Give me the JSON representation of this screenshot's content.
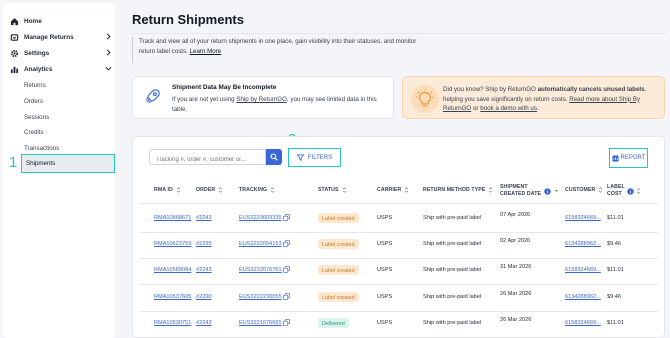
{
  "sidebar": {
    "home": "Home",
    "manage_returns": "Manage Returns",
    "settings": "Settings",
    "analytics": "Analytics",
    "analytics_items": [
      "Returns",
      "Orders",
      "Sessions",
      "Credits",
      "Transactions",
      "Shipments"
    ]
  },
  "annotations": [
    "1",
    "2",
    "3"
  ],
  "header": {
    "title": "Return Shipments",
    "intro": "Track and view all of your return shipments in one place, gain visibility into their statuses, and monitor return label costs.",
    "learn_more": "Learn More"
  },
  "notice": {
    "title": "Shipment Data May Be Incomplete",
    "text_before": "If you are not yet using",
    "link": "Ship by ReturnGO",
    "text_after": ", you may see limited data in this table."
  },
  "tip": {
    "text1": "Did you know? Ship by ReturnGO",
    "bold": "automatically cancels unused labels",
    "text2": ", helping you save significantly on return costs.",
    "link1": "Read more about Ship By ReturnGO",
    "text3": "or",
    "link2": "book a demo with us",
    "text4": "."
  },
  "toolbar": {
    "search_placeholder": "Tracking #, order #, customer or...",
    "filters_label": "FILTERS",
    "report_label": "REPORT"
  },
  "table": {
    "headers": {
      "rma": "RMA ID",
      "order": "ORDER",
      "tracking": "TRACKING",
      "status": "STATUS",
      "carrier": "CARRIER",
      "method": "RETURN METHOD TYPE",
      "created1": "SHIPMENT",
      "created2": "CREATED DATE",
      "customer": "CUSTOMER",
      "cost1": "LABEL",
      "cost2": "COST"
    },
    "rows": [
      {
        "rma": "RMA10868671",
        "order": "#2243",
        "tracking": "EUS3223603335",
        "status": "Label created",
        "carrier": "USPS",
        "method": "Ship with pre-paid label",
        "date": "07 Apr 2026",
        "customer": "6158324669...",
        "cost": "$11.01"
      },
      {
        "rma": "RMA10623759",
        "order": "#2295",
        "tracking": "EUS3222654153",
        "status": "Label created",
        "carrier": "USPS",
        "method": "Ship with pre-paid label",
        "date": "02 Apr 2026",
        "customer": "6134288962...",
        "cost": "$9.46"
      },
      {
        "rma": "RMA10589084",
        "order": "#2243",
        "tracking": "EUS3222076761",
        "status": "Label created",
        "carrier": "USPS",
        "method": "Ship with pre-paid label",
        "date": "31 Mar 2026",
        "customer": "6158324669...",
        "cost": "$11.01"
      },
      {
        "rma": "RMA10537605",
        "order": "#2290",
        "tracking": "EUS3222230055",
        "status": "Label created",
        "carrier": "USPS",
        "method": "Ship with pre-paid label",
        "date": "26 Mar 2026",
        "customer": "6134288962...",
        "cost": "$9.46"
      },
      {
        "rma": "RMA10530751",
        "order": "#2243",
        "tracking": "EUS3221076665",
        "status": "Delivered",
        "carrier": "USPS",
        "method": "Ship with pre-paid label",
        "date": "26 Mar 2026",
        "customer": "6158324669...",
        "cost": "$11.01"
      }
    ]
  },
  "colors": {
    "accent": "#22c7bf",
    "link": "#3a66d6",
    "label_created_bg": "#fde8cf",
    "delivered_bg": "#d8f4ec"
  }
}
